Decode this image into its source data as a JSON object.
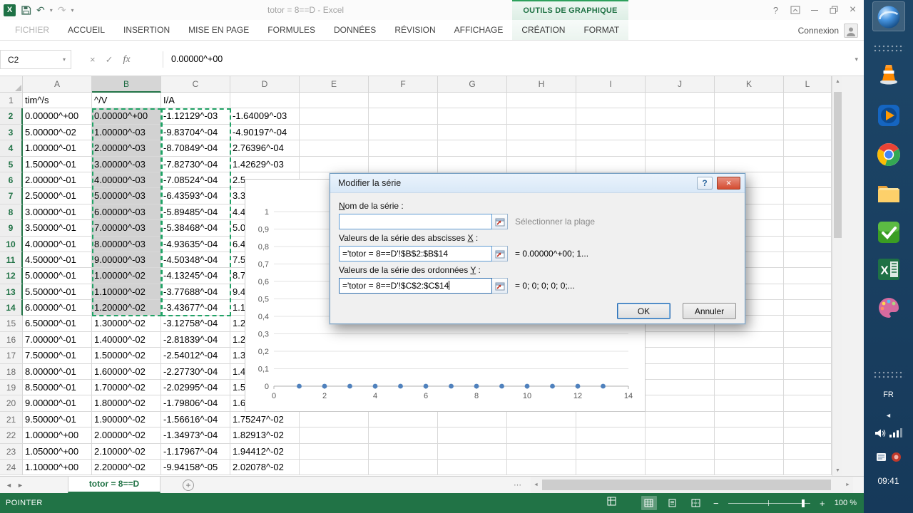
{
  "window": {
    "title": "totor = 8==D - Excel",
    "contextual_group": "OUTILS DE GRAPHIQUE",
    "account": "Connexion",
    "help": "?"
  },
  "ribbon": {
    "tabs": [
      {
        "label": "FICHIER",
        "type": "file"
      },
      {
        "label": "ACCUEIL"
      },
      {
        "label": "INSERTION"
      },
      {
        "label": "MISE EN PAGE"
      },
      {
        "label": "FORMULES"
      },
      {
        "label": "DONNÉES"
      },
      {
        "label": "RÉVISION"
      },
      {
        "label": "AFFICHAGE"
      },
      {
        "label": "CRÉATION",
        "contextual": true
      },
      {
        "label": "FORMAT",
        "contextual": true
      }
    ]
  },
  "formula_bar": {
    "name_box": "C2",
    "value": "0.00000^+00",
    "fx_label": "fx"
  },
  "grid": {
    "col_headers": [
      "A",
      "B",
      "C",
      "D",
      "E",
      "F",
      "G",
      "H",
      "I",
      "J",
      "K",
      "L"
    ],
    "selected_col": "B",
    "selected_rows": [
      2,
      14
    ],
    "rows": [
      [
        "tim^/s",
        "^/V",
        "I/A",
        ""
      ],
      [
        "0.00000^+00",
        "0.00000^+00",
        "-1.12129^-03",
        "-1.64009^-03"
      ],
      [
        "5.00000^-02",
        "1.00000^-03",
        "-9.83704^-04",
        "-4.90197^-04"
      ],
      [
        "1.00000^-01",
        "2.00000^-03",
        "-8.70849^-04",
        "2.76396^-04"
      ],
      [
        "1.50000^-01",
        "3.00000^-03",
        "-7.82730^-04",
        "1.42629^-03"
      ],
      [
        "2.00000^-01",
        "4.00000^-03",
        "-7.08524^-04",
        "2.5"
      ],
      [
        "2.50000^-01",
        "5.00000^-03",
        "-6.43593^-04",
        "3.3"
      ],
      [
        "3.00000^-01",
        "6.00000^-03",
        "-5.89485^-04",
        "4.4"
      ],
      [
        "3.50000^-01",
        "7.00000^-03",
        "-5.38468^-04",
        "5.0"
      ],
      [
        "4.00000^-01",
        "8.00000^-03",
        "-4.93635^-04",
        "6.4"
      ],
      [
        "4.50000^-01",
        "9.00000^-03",
        "-4.50348^-04",
        "7.5"
      ],
      [
        "5.00000^-01",
        "1.00000^-02",
        "-4.13245^-04",
        "8.7"
      ],
      [
        "5.50000^-01",
        "1.10000^-02",
        "-3.77688^-04",
        "9.4"
      ],
      [
        "6.00000^-01",
        "1.20000^-02",
        "-3.43677^-04",
        "1.1"
      ],
      [
        "6.50000^-01",
        "1.30000^-02",
        "-3.12758^-04",
        "1.2"
      ],
      [
        "7.00000^-01",
        "1.40000^-02",
        "-2.81839^-04",
        "1.2"
      ],
      [
        "7.50000^-01",
        "1.50000^-02",
        "-2.54012^-04",
        "1.3"
      ],
      [
        "8.00000^-01",
        "1.60000^-02",
        "-2.27730^-04",
        "1.4"
      ],
      [
        "8.50000^-01",
        "1.70000^-02",
        "-2.02995^-04",
        "1.5"
      ],
      [
        "9.00000^-01",
        "1.80000^-02",
        "-1.79806^-04",
        "1.6"
      ],
      [
        "9.50000^-01",
        "1.90000^-02",
        "-1.56616^-04",
        "1.75247^-02"
      ],
      [
        "1.00000^+00",
        "2.00000^-02",
        "-1.34973^-04",
        "1.82913^-02"
      ],
      [
        "1.05000^+00",
        "2.10000^-02",
        "-1.17967^-04",
        "1.94412^-02"
      ],
      [
        "1.10000^+00",
        "2.20000^-02",
        "-9.94158^-05",
        "2.02078^-02"
      ]
    ]
  },
  "dialog": {
    "title": "Modifier la série",
    "name_label": {
      "pre": "",
      "key": "N",
      "post": "om de la série :"
    },
    "name_value": "",
    "name_hint": "Sélectionner la plage",
    "x_label": {
      "pre": "Valeurs de la série des abscisses ",
      "key": "X",
      "post": " :"
    },
    "x_value": "='totor = 8==D'!$B$2:$B$14",
    "x_preview": "= 0.00000^+00; 1...",
    "y_label": {
      "pre": "Valeurs de la série des ordonnées ",
      "key": "Y",
      "post": " :"
    },
    "y_value": "='totor = 8==D'!$C$2:$C$14",
    "y_preview": "= 0; 0; 0; 0; 0;...",
    "ok_label": "OK",
    "cancel_label": "Annuler"
  },
  "chart_data": {
    "type": "scatter",
    "x": [
      1,
      2,
      3,
      4,
      5,
      6,
      7,
      8,
      9,
      10,
      11,
      12,
      13
    ],
    "y": [
      0,
      0,
      0,
      0,
      0,
      0,
      0,
      0,
      0,
      0,
      0,
      0,
      0
    ],
    "xlim": [
      0,
      14
    ],
    "ylim": [
      0,
      1
    ],
    "x_ticks": [
      "0",
      "2",
      "4",
      "6",
      "8",
      "10",
      "12",
      "14"
    ],
    "y_ticks": [
      "1",
      "0,9",
      "0,8",
      "0,7",
      "0,6",
      "0,5",
      "0,4",
      "0,3",
      "0,2",
      "0,1",
      "0"
    ],
    "grid": "horizontal",
    "legend": "none",
    "title": "",
    "xlabel": "",
    "ylabel": "",
    "point_color": "#4f81bd"
  },
  "sheet_bar": {
    "active_tab": "totor = 8==D"
  },
  "status_bar": {
    "mode": "POINTER",
    "zoom_label": "100 %"
  },
  "taskbar": {
    "icons": [
      "browser-orb",
      "vlc",
      "media-player",
      "chrome",
      "folder-explorer",
      "green-utility",
      "excel",
      "paint-palette"
    ],
    "language": "FR",
    "clock": "09:41"
  }
}
